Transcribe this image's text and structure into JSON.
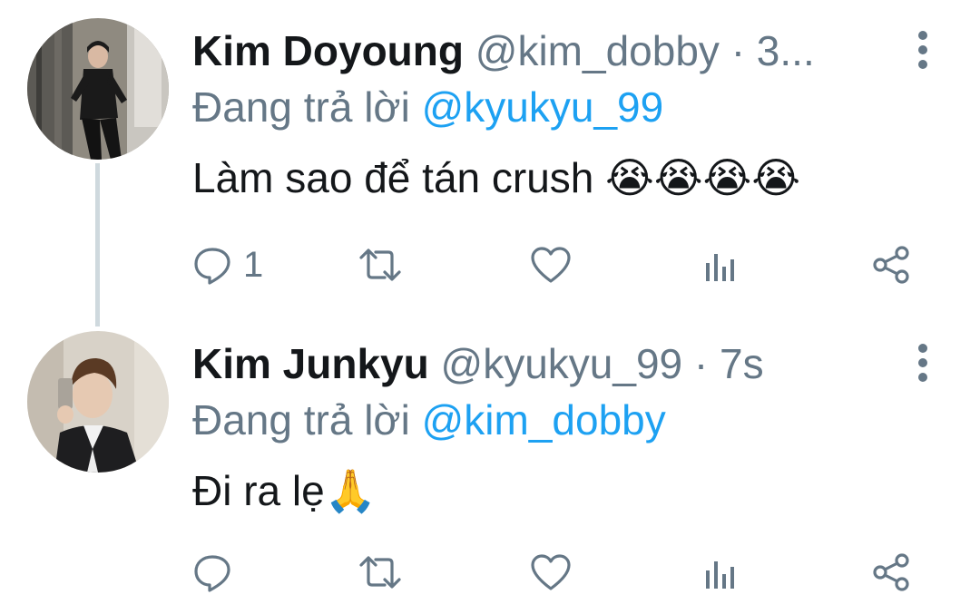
{
  "tweets": [
    {
      "display_name": "Kim Doyoung",
      "meta": "@kim_dobby · 3...",
      "reply_prefix": "Đang trả lời",
      "reply_handle": "@kyukyu_99",
      "text": "Làm sao để tán crush 😭😭😭😭",
      "reply_count": "1",
      "icons": [
        "reply-icon",
        "retweet-icon",
        "like-icon",
        "views-icon",
        "share-icon"
      ]
    },
    {
      "display_name": "Kim Junkyu",
      "meta": "@kyukyu_99 · 7s",
      "reply_prefix": "Đang trả lời",
      "reply_handle": "@kim_dobby",
      "text": "Đi ra lẹ🙏",
      "reply_count": "",
      "icons": [
        "reply-icon",
        "retweet-icon",
        "like-icon",
        "views-icon",
        "share-icon"
      ]
    }
  ],
  "colors": {
    "text": "#14171a",
    "muted": "#657786",
    "accent": "#1da1f2",
    "thread_line": "#cfd9de"
  }
}
